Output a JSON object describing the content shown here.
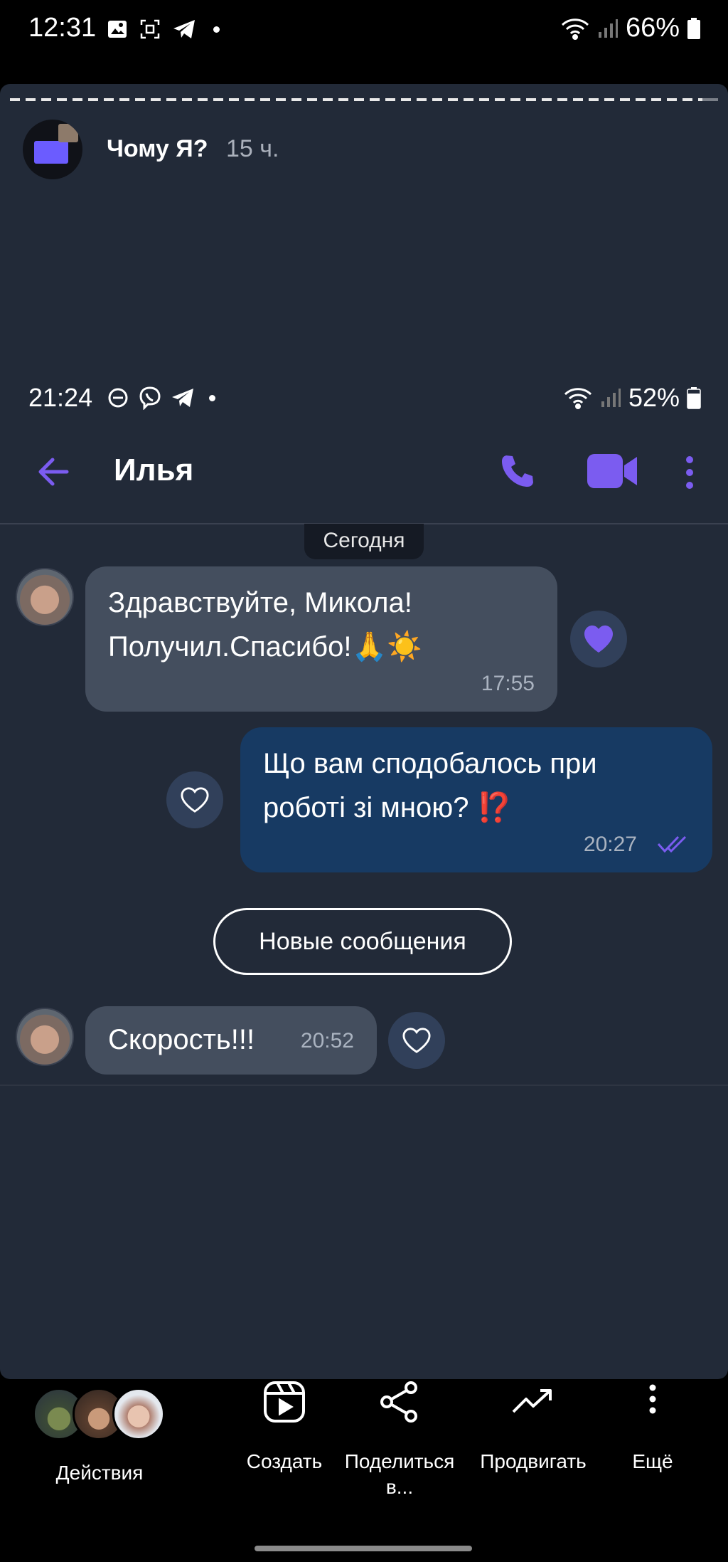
{
  "status_bar": {
    "time": "12:31",
    "battery": "66%"
  },
  "story": {
    "author": "Чому Я?",
    "age": "15 ч."
  },
  "inner_status_bar": {
    "time": "21:24",
    "battery": "52%"
  },
  "chat": {
    "title": "Илья",
    "date_label": "Сегодня",
    "messages": [
      {
        "line1": "Здравствуйте, Микола!",
        "line2": "Получил.Спасибо!🙏☀️",
        "time": "17:55"
      },
      {
        "line1": "Що вам сподобалось при",
        "line2": "роботі зі мною? ⁉️",
        "time": "20:27"
      },
      {
        "text": "Скорость!!!",
        "time": "20:52"
      }
    ],
    "new_messages_label": "Новые сообщения"
  },
  "bottom_bar": {
    "actions_label": "Действия",
    "create_label": "Создать",
    "share_label": "Поделиться в...",
    "promote_label": "Продвигать",
    "more_label": "Ещё"
  },
  "colors": {
    "accent": "#7b5cf0",
    "card_bg": "#222a38",
    "incoming": "#444e5e",
    "outgoing": "#173a63"
  }
}
